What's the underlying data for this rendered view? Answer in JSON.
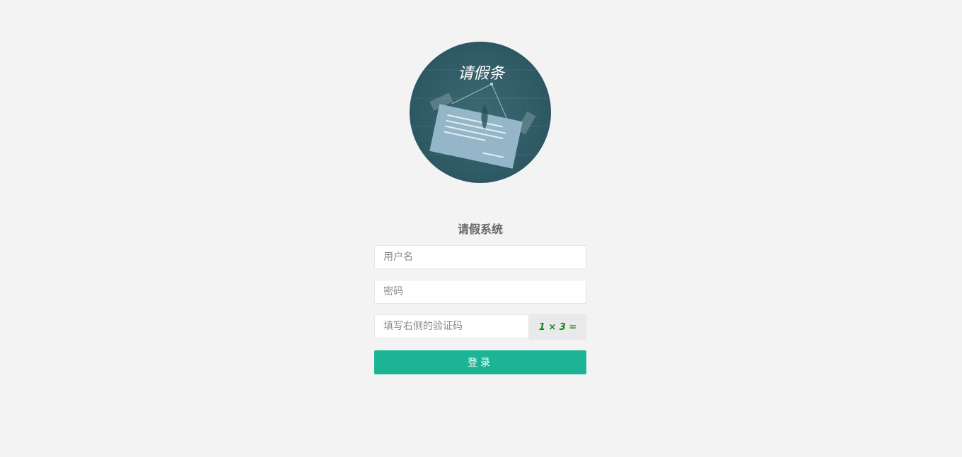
{
  "logo": {
    "calligraphy_text": "请假条",
    "icon": "leave-slip-logo"
  },
  "title": "请假系统",
  "form": {
    "username_placeholder": "用户名",
    "password_placeholder": "密码",
    "captcha_placeholder": "填写右侧的验证码",
    "captcha_text": "1 × 3 =",
    "submit_label": "登录"
  },
  "colors": {
    "background": "#f3f3f3",
    "logo_bg": "#2f5b66",
    "button": "#1bb495",
    "captcha_text": "#0b8a12"
  }
}
